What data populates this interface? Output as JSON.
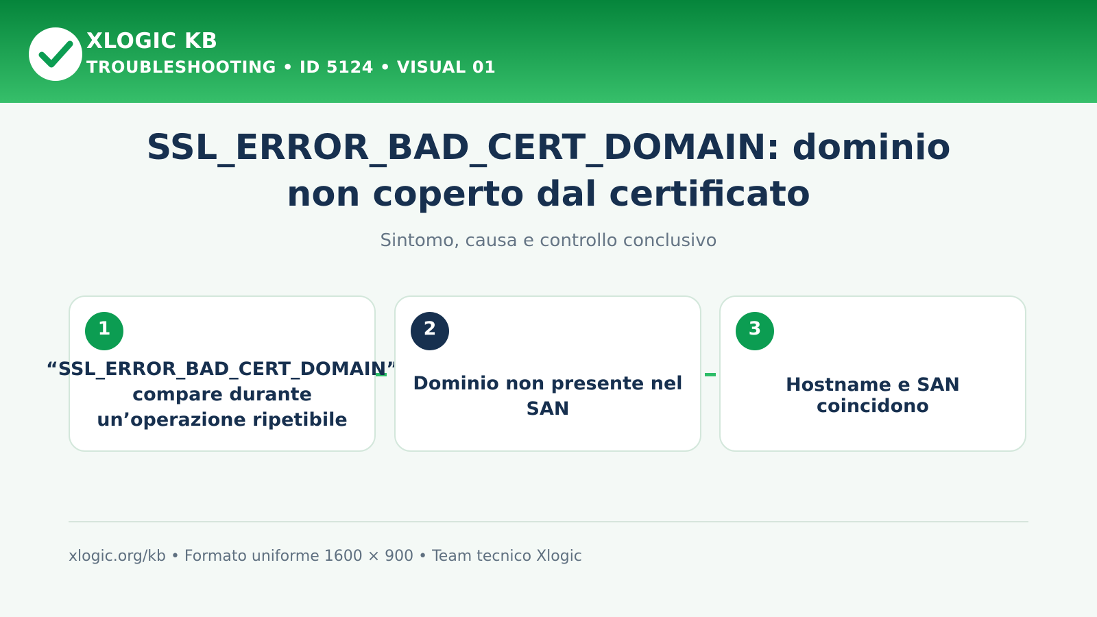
{
  "header": {
    "brand": "XLOGIC KB",
    "subtitle": "TROUBLESHOOTING • ID 5124 • VISUAL 01",
    "logo_icon": "check-icon",
    "gradient_top": "#05853b",
    "gradient_bottom": "#36bf6a"
  },
  "title": {
    "line1": "SSL_ERROR_BAD_CERT_DOMAIN: dominio",
    "line2": "non coperto dal certificato"
  },
  "subtitle": "Sintomo, causa e controllo conclusivo",
  "steps": [
    {
      "number": "1",
      "badge_color": "#0c9d52",
      "lines": [
        "“SSL_ERROR_BAD_CERT_DOMAIN”",
        "compare durante",
        "un’operazione ripetibile"
      ]
    },
    {
      "number": "2",
      "badge_color": "#17304f",
      "lines": [
        "Dominio non presente nel",
        "SAN"
      ]
    },
    {
      "number": "3",
      "badge_color": "#0c9d52",
      "lines": [
        "Hostname e SAN",
        "coincidono"
      ]
    }
  ],
  "footer": "xlogic.org/kb • Formato uniforme 1600 × 900 • Team tecnico Xlogic",
  "colors": {
    "text_dark": "#17304f",
    "accent_green": "#2ebd68"
  }
}
